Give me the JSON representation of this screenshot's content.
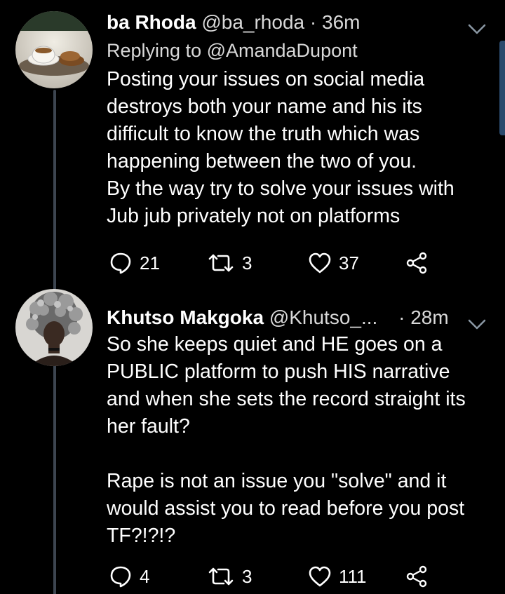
{
  "tweets": [
    {
      "display_name": "ba Rhoda",
      "handle": "@ba_rhoda",
      "separator": "·",
      "time": "36m",
      "reply_to": "Replying to @AmandaDupont",
      "text": "Posting your issues on social media\ndestroys both your name and his its\ndifficult to know the truth which was\nhappening between the two of you.\nBy the way try to solve your issues with\nJub jub privately not on platforms",
      "replies": "21",
      "retweets": "3",
      "likes": "37"
    },
    {
      "display_name": "Khutso Makgoka",
      "handle": "@Khutso_...",
      "separator": "·",
      "time": "28m",
      "text": "So she keeps quiet and HE goes on a\nPUBLIC platform to push HIS narrative\nand when she sets the record straight its\nher fault?\n\nRape is not an issue you \"solve\" and it\nwould assist you to read before you post\nTF?!?!?",
      "replies": "4",
      "retweets": "3",
      "likes": "111"
    }
  ],
  "icons": {
    "reply": "reply-icon",
    "retweet": "retweet-icon",
    "like": "heart-icon",
    "share": "share-icon",
    "more": "chevron-down-icon"
  },
  "colors": {
    "background": "#000000",
    "thread_line": "#3d4550",
    "scrollbar": "#2b4a6d"
  }
}
